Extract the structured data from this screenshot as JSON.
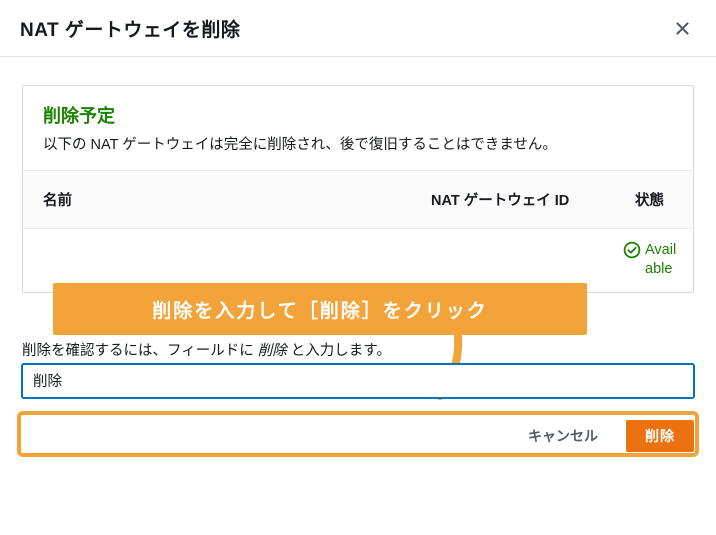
{
  "dialog": {
    "title": "NAT ゲートウェイを削除"
  },
  "panel": {
    "heading": "削除予定",
    "description": "以下の NAT ゲートウェイは完全に削除され、後で復旧することはできません。"
  },
  "table": {
    "headers": {
      "name": "名前",
      "nat_id": "NAT ゲートウェイ ID",
      "state": "状態"
    },
    "rows": [
      {
        "name": "",
        "nat_id": "",
        "state_label": "Available",
        "state_kind": "ok"
      }
    ]
  },
  "annotation": {
    "instruction": "削除を入力して［削除］をクリック"
  },
  "confirm": {
    "label_prefix": "削除を確認するには、フィールドに ",
    "label_keyword": "削除",
    "label_suffix": " と入力します。",
    "input_value": "削除"
  },
  "footer": {
    "cancel": "キャンセル",
    "delete": "削除"
  },
  "colors": {
    "accent_orange": "#ec7211",
    "annotation_orange": "#f2a33a",
    "success_green": "#1d8102",
    "link_blue": "#0073bb"
  }
}
